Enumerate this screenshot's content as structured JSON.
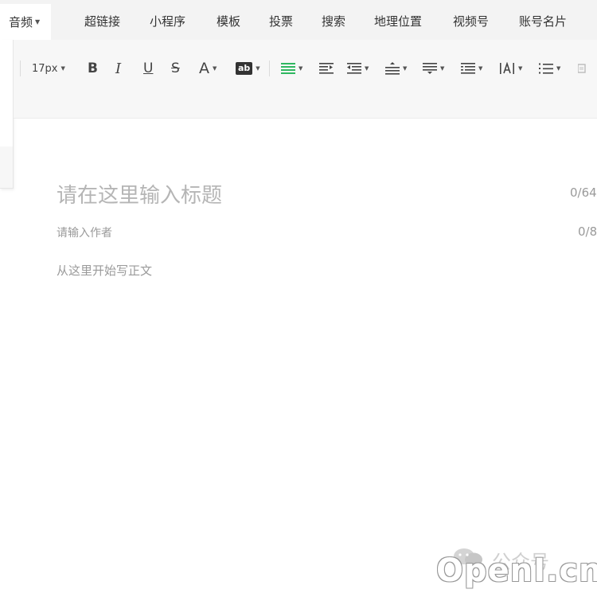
{
  "insert_menu": {
    "audio": "音频",
    "items": [
      "超链接",
      "小程序",
      "模板",
      "投票",
      "搜索",
      "地理位置",
      "视频号",
      "账号名片"
    ]
  },
  "toolbar": {
    "font_size": "17px",
    "bold": "B",
    "italic": "I",
    "underline": "U",
    "strike": "S",
    "font_color": "A",
    "bg_color": "ab",
    "accent_color": "#2fb760"
  },
  "editor": {
    "title_placeholder": "请在这里输入标题",
    "title_count": "0/64",
    "author_placeholder": "请输入作者",
    "author_count": "0/8",
    "body_placeholder": "从这里开始写正文"
  },
  "watermark": {
    "account_label": "公众号",
    "site": "OpenI.cn"
  }
}
